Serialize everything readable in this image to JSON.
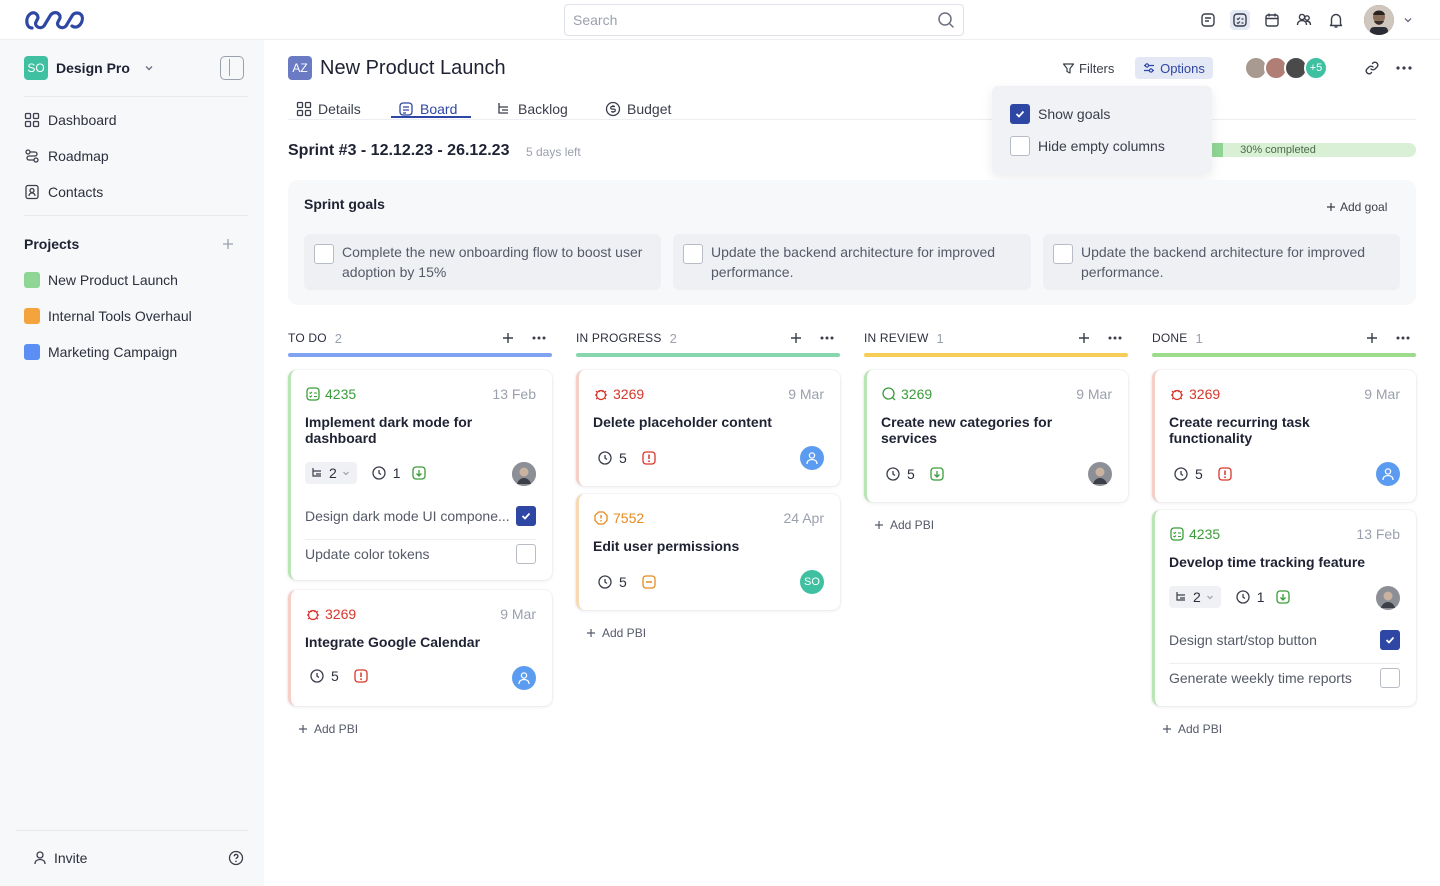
{
  "topbar": {
    "search_placeholder": "Search"
  },
  "workspace": {
    "badge": "SO",
    "name": "Design Pro"
  },
  "nav": [
    {
      "label": "Dashboard"
    },
    {
      "label": "Roadmap"
    },
    {
      "label": "Contacts"
    }
  ],
  "projects": {
    "title": "Projects",
    "items": [
      {
        "label": "New Product Launch",
        "color": "#8fd694"
      },
      {
        "label": "Internal Tools Overhaul",
        "color": "#f5a33c"
      },
      {
        "label": "Marketing Campaign",
        "color": "#5b8ff5"
      }
    ]
  },
  "footer": {
    "invite": "Invite"
  },
  "header": {
    "badge": "AZ",
    "title": "New Product Launch",
    "filters": "Filters",
    "options": "Options",
    "more_avatars": "+5"
  },
  "tabs": [
    {
      "label": "Details"
    },
    {
      "label": "Board"
    },
    {
      "label": "Backlog"
    },
    {
      "label": "Budget"
    }
  ],
  "sprint": {
    "title": "Sprint #3 - 12.12.23 - 26.12.23",
    "days_left": "5 days left",
    "progress_label": "30% completed",
    "progress": 0.3
  },
  "options_menu": {
    "show_goals": "Show goals",
    "hide_empty": "Hide empty columns"
  },
  "goals": {
    "title": "Sprint goals",
    "add": "Add goal",
    "items": [
      "Complete the new onboarding flow to boost user adoption by 15%",
      "Update the backend architecture for improved performance.",
      "Update the backend architecture for improved performance."
    ]
  },
  "columns": [
    {
      "name": "TO DO",
      "count": "2",
      "color": "#7fa3f0"
    },
    {
      "name": "IN PROGRESS",
      "count": "2",
      "color": "#86d6b0"
    },
    {
      "name": "IN REVIEW",
      "count": "1",
      "color": "#f7cd5a"
    },
    {
      "name": "DONE",
      "count": "1",
      "color": "#9ddc8c"
    }
  ],
  "add_pbi": "Add PBI",
  "cards": {
    "c1": {
      "id": "4235",
      "date": "13 Feb",
      "title": "Implement dark mode for dashboard",
      "subtasks": "2",
      "time": "1",
      "tasks": [
        "Design dark mode UI compone...",
        "Update color tokens"
      ]
    },
    "c2": {
      "id": "3269",
      "date": "9 Mar",
      "title": "Integrate Google Calendar",
      "time": "5"
    },
    "c3": {
      "id": "3269",
      "date": "9 Mar",
      "title": "Delete placeholder content",
      "time": "5"
    },
    "c4": {
      "id": "7552",
      "date": "24 Apr",
      "title": "Edit user permissions",
      "time": "5",
      "avatar": "SO"
    },
    "c5": {
      "id": "3269",
      "date": "9 Mar",
      "title": "Create new categories for services",
      "time": "5"
    },
    "c6": {
      "id": "3269",
      "date": "9 Mar",
      "title": "Create recurring task functionality",
      "time": "5"
    },
    "c7": {
      "id": "4235",
      "date": "13 Feb",
      "title": "Develop time tracking feature",
      "subtasks": "2",
      "time": "1",
      "tasks": [
        "Design start/stop button",
        "Generate weekly time reports"
      ]
    }
  }
}
